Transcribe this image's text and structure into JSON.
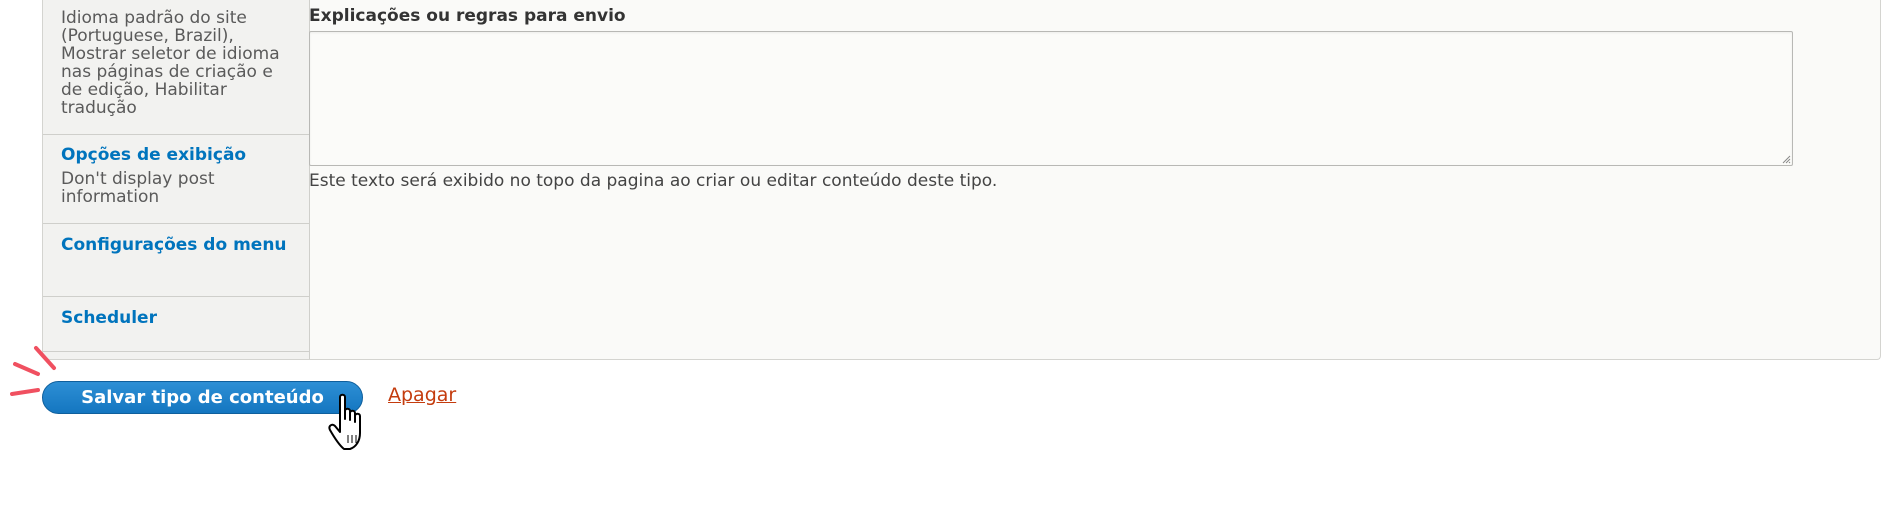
{
  "sidebar": {
    "items": [
      {
        "summary": "Idioma padrão do site (Portuguese, Brazil), Mostrar seletor de idioma nas páginas de criação e de edição, Habilitar tradução"
      },
      {
        "label": "Opções de exibição",
        "summary": "Don't display post information"
      },
      {
        "label": "Configurações do menu"
      },
      {
        "label": "Scheduler"
      }
    ]
  },
  "form": {
    "field_label": "Explicações ou regras para envio",
    "textarea_value": "",
    "description": "Este texto será exibido no topo da pagina ao criar ou editar conteúdo deste tipo."
  },
  "actions": {
    "save_label": "Salvar tipo de conteúdo",
    "delete_label": "Apagar"
  },
  "colors": {
    "link": "#0074bd",
    "button": "#1a7fc8",
    "delete": "#c43c0e"
  }
}
